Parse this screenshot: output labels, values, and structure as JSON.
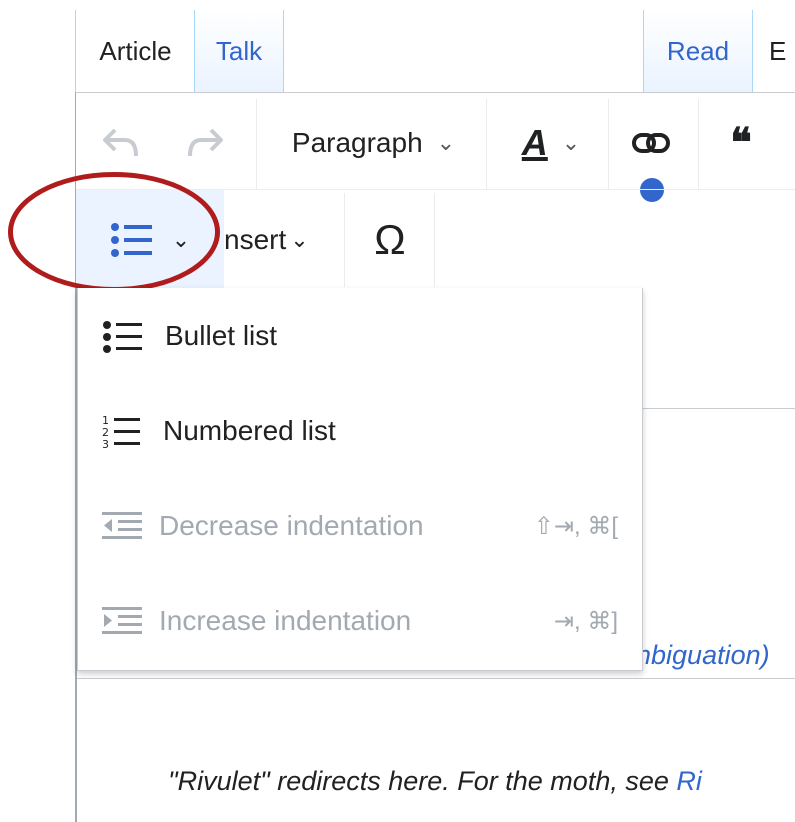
{
  "tabs": {
    "article": "Article",
    "talk": "Talk",
    "read": "Read",
    "edit_partial": "E"
  },
  "toolbar": {
    "undo_icon": "undo-icon",
    "redo_icon": "redo-icon",
    "paragraph_label": "Paragraph",
    "text_style_letter": "A",
    "link_icon": "link-icon",
    "quote_glyph": "❝",
    "list_icon": "bullet-list-icon",
    "insert_label": "nsert",
    "special_char_glyph": "Ω",
    "chevron_glyph": "⌄"
  },
  "list_menu": {
    "items": [
      {
        "label": "Bullet list",
        "shortcut": "",
        "enabled": true,
        "icon": "bullet-list-icon"
      },
      {
        "label": "Numbered list",
        "shortcut": "",
        "enabled": true,
        "icon": "numbered-list-icon"
      },
      {
        "label": "Decrease indentation",
        "shortcut": "⇧⇥, ⌘[",
        "enabled": false,
        "icon": "outdent-icon"
      },
      {
        "label": "Increase indentation",
        "shortcut": "⇥, ⌘]",
        "enabled": false,
        "icon": "indent-icon"
      }
    ]
  },
  "content": {
    "disambiguation_fragment": "nbiguation)",
    "hatnote_text": "\"Rivulet\" redirects here. For the moth, see ",
    "hatnote_link": "Ri"
  },
  "colors": {
    "link": "#3366cc",
    "annotation_circle": "#b01c1c",
    "notification_dot": "#3366cc",
    "active_button_bg": "#eaf3ff"
  }
}
